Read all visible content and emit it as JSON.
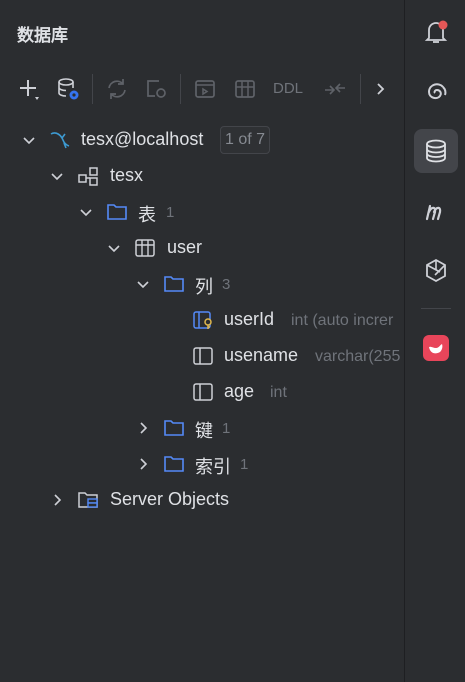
{
  "panel": {
    "title": "数据库"
  },
  "toolbar": {
    "ddl_label": "DDL"
  },
  "tree": {
    "connection": {
      "label": "tesx@localhost",
      "badge": "1 of 7"
    },
    "schema": {
      "label": "tesx"
    },
    "tables_folder": {
      "label": "表",
      "count": "1"
    },
    "table": {
      "label": "user"
    },
    "columns_folder": {
      "label": "列",
      "count": "3"
    },
    "columns": [
      {
        "name": "userId",
        "type": "int (auto increr"
      },
      {
        "name": "usename",
        "type": "varchar(255"
      },
      {
        "name": "age",
        "type": "int"
      }
    ],
    "keys_folder": {
      "label": "键",
      "count": "1"
    },
    "indexes_folder": {
      "label": "索引",
      "count": "1"
    },
    "server_objects": {
      "label": "Server Objects"
    }
  },
  "colors": {
    "background": "#2b2d30",
    "folder_blue": "#548af7",
    "mysql_blue": "#3d9ad1",
    "notification_dot": "#e55757",
    "muted_text": "#6f737a"
  }
}
